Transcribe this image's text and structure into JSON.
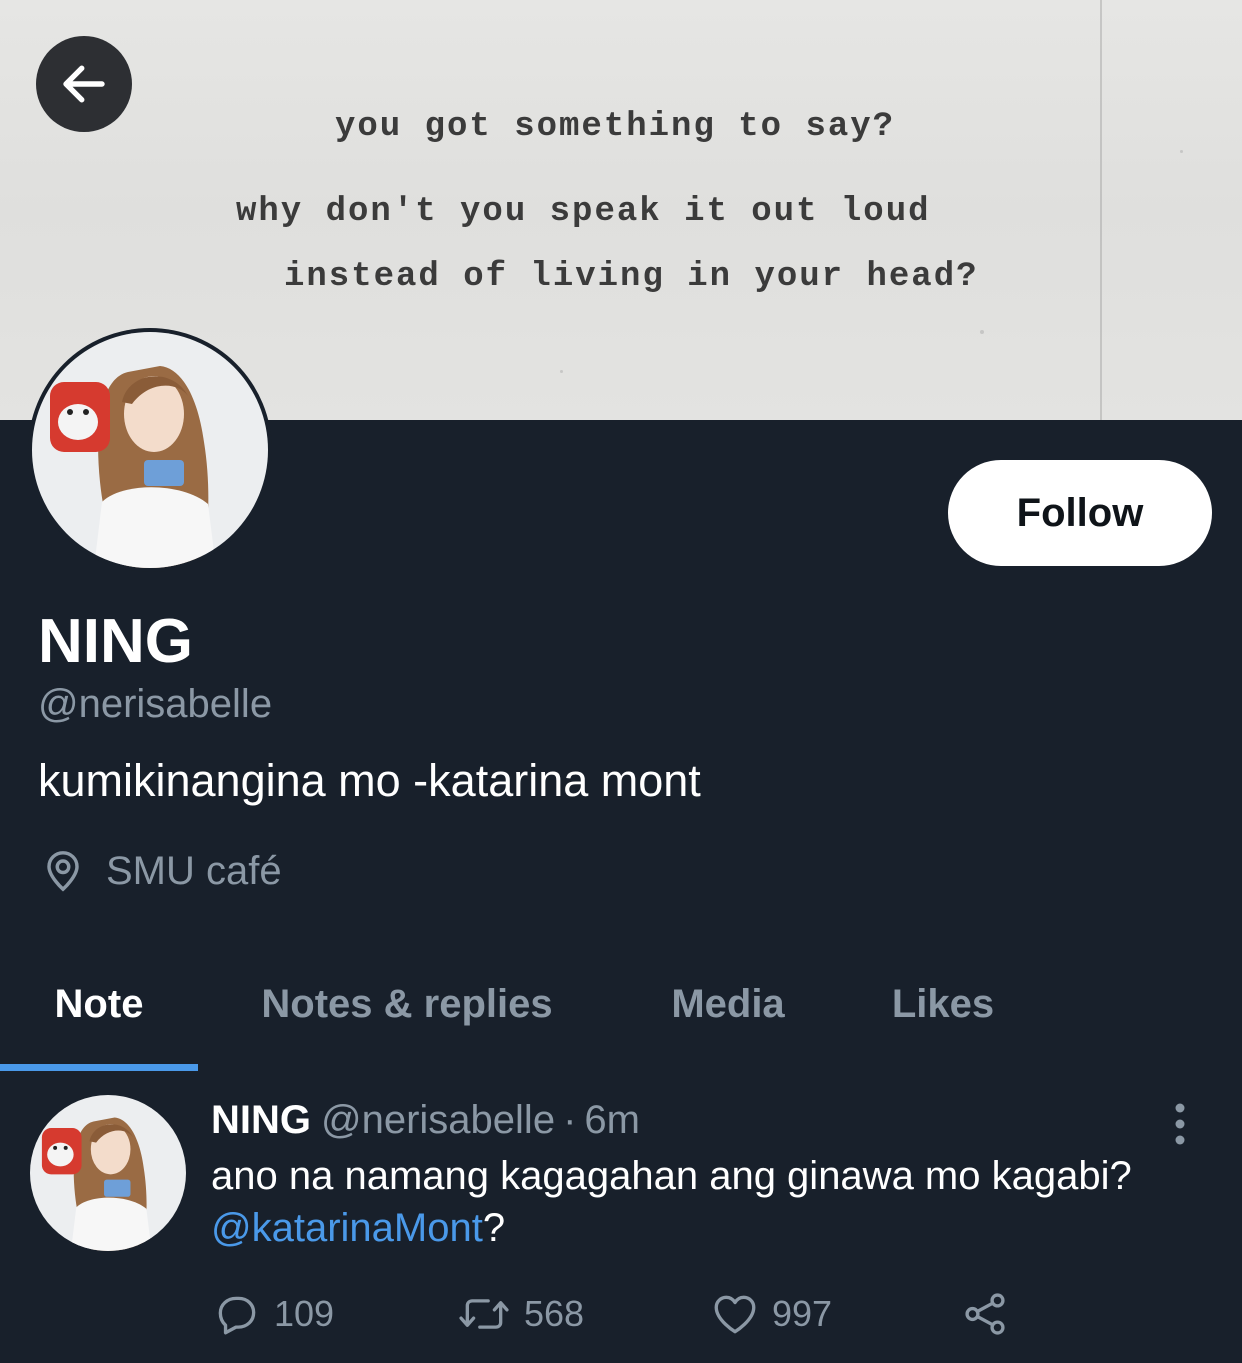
{
  "banner": {
    "lines": [
      "you got something to say?",
      "why don't you speak it out loud",
      "instead of living in your head?"
    ]
  },
  "profile": {
    "display_name": "NING",
    "handle": "@nerisabelle",
    "bio": "kumikinangina mo -katarina mont",
    "location": "SMU café",
    "follow_label": "Follow"
  },
  "tabs": [
    {
      "label": "Note",
      "active": true
    },
    {
      "label": "Notes & replies",
      "active": false
    },
    {
      "label": "Media",
      "active": false
    },
    {
      "label": "Likes",
      "active": false
    }
  ],
  "tweet": {
    "name": "NING",
    "handle": "@nerisabelle",
    "separator": "·",
    "time": "6m",
    "text_before": "ano na namang kagagahan ang ginawa mo kagabi? ",
    "mention": "@katarinaMont",
    "text_after": "?",
    "replies": "109",
    "retweets": "568",
    "likes": "997"
  },
  "icons": {
    "back": "arrow-left-icon",
    "location": "location-pin-icon",
    "more": "more-vertical-icon",
    "reply": "reply-icon",
    "retweet": "retweet-icon",
    "like": "heart-icon",
    "share": "share-icon"
  },
  "colors": {
    "background": "#18202b",
    "accent": "#4a99e9",
    "secondary_text": "#8b98a5",
    "primary_text": "#ffffff"
  }
}
